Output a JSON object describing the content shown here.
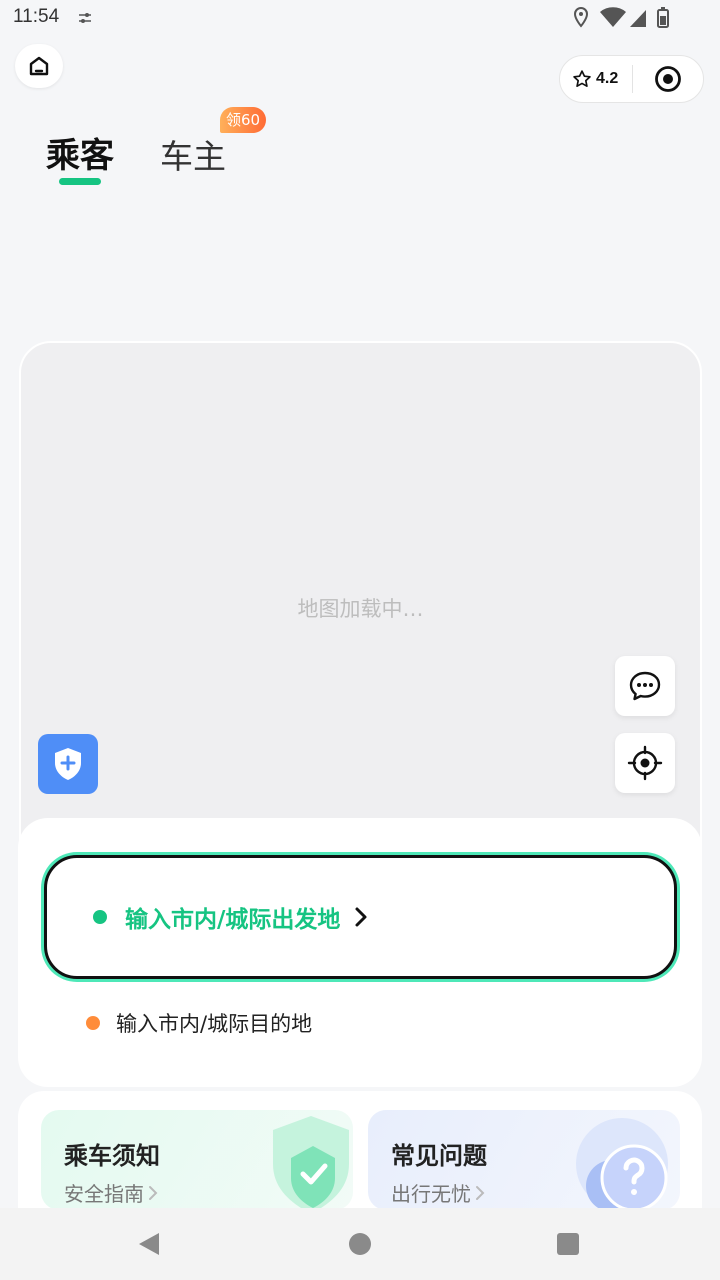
{
  "status_bar": {
    "time": "11:54"
  },
  "capsule": {
    "rating": "4.2"
  },
  "tabs": [
    {
      "label": "乘客",
      "active": true
    },
    {
      "label": "车主",
      "badge": "领60"
    }
  ],
  "map": {
    "loading_text": "地图加载中…"
  },
  "route": {
    "start_placeholder": "输入市内/城际出发地",
    "destination_placeholder": "输入市内/城际目的地"
  },
  "services": [
    {
      "title": "乘车须知",
      "subtitle": "安全指南"
    },
    {
      "title": "常见问题",
      "subtitle": "出行无忧"
    }
  ],
  "colors": {
    "accent": "#16c482",
    "accent_border": "#4ee8b8",
    "destination_dot": "#ff8c3a",
    "badge_start": "#ffb05a",
    "badge_end": "#ff6b35",
    "shield_button": "#4f8ef7"
  },
  "icons": {
    "home": "home-icon",
    "star": "star-icon",
    "target": "target-icon",
    "chat": "chat-bubble-icon",
    "locate": "crosshair-locate-icon",
    "shield": "shield-plus-icon"
  }
}
